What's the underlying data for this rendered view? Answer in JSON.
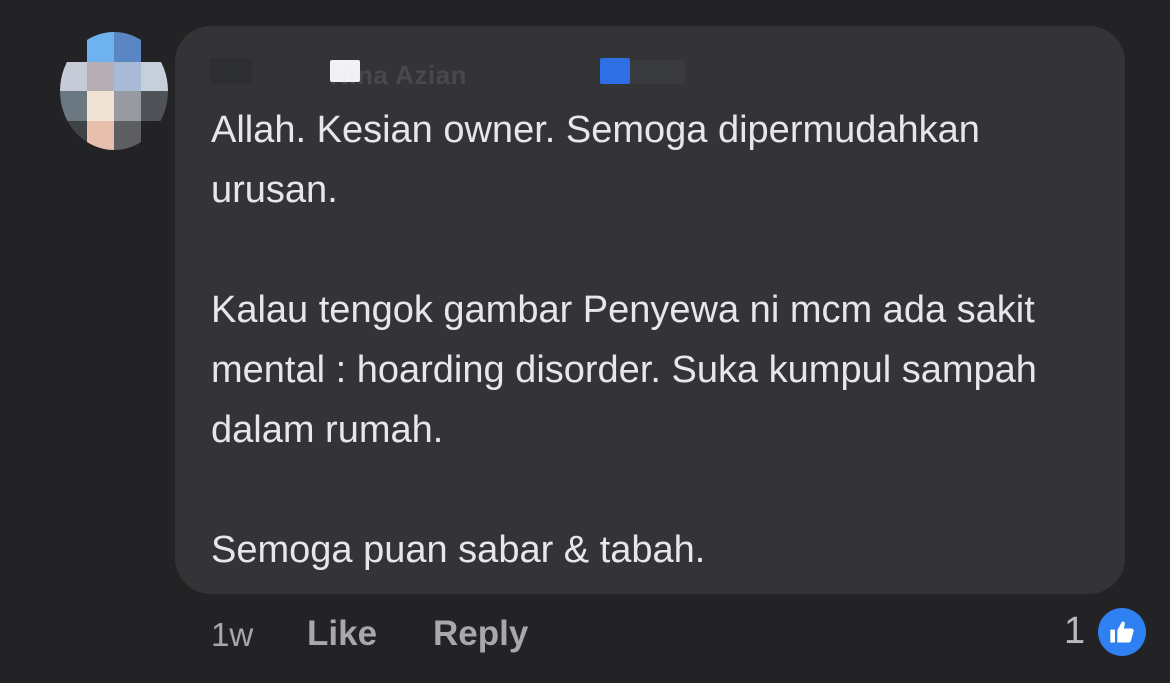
{
  "comment": {
    "author": {
      "name": "Nina Azian",
      "avatar_icon": "pixelated-avatar-icon"
    },
    "paragraphs": [
      "Allah. Kesian owner. Semoga dipermudahkan urusan.",
      "Kalau tengok gambar Penyewa ni mcm ada sakit mental : hoarding disorder. Suka kumpul sampah dalam rumah.",
      "Semoga puan sabar & tabah."
    ],
    "footer": {
      "time": "1w",
      "like_label": "Like",
      "reply_label": "Reply",
      "reaction_count": "1",
      "reaction_icon": "thumbs-up-icon"
    }
  },
  "colors": {
    "background": "#232325",
    "bubble": "#343436",
    "text": "#e6e7ea",
    "muted": "#a6a8ad",
    "like_blue": "#2f80f2"
  }
}
